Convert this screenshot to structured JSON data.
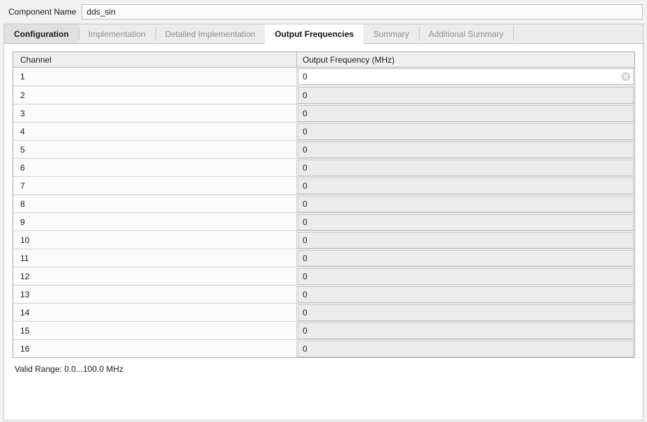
{
  "component": {
    "label": "Component Name",
    "value": "dds_sin",
    "placeholder": ""
  },
  "tabs": [
    {
      "label": "Configuration",
      "state": "selected"
    },
    {
      "label": "Implementation",
      "state": "inactive"
    },
    {
      "label": "Detailed Implementation",
      "state": "inactive"
    },
    {
      "label": "Output Frequencies",
      "state": "active"
    },
    {
      "label": "Summary",
      "state": "inactive"
    },
    {
      "label": "Additional Summary",
      "state": "inactive"
    }
  ],
  "table": {
    "columns": [
      "Channel",
      "Output Frequency (MHz)"
    ],
    "rows": [
      {
        "channel": "1",
        "frequency": "0",
        "focused": true
      },
      {
        "channel": "2",
        "frequency": "0",
        "focused": false
      },
      {
        "channel": "3",
        "frequency": "0",
        "focused": false
      },
      {
        "channel": "4",
        "frequency": "0",
        "focused": false
      },
      {
        "channel": "5",
        "frequency": "0",
        "focused": false
      },
      {
        "channel": "6",
        "frequency": "0",
        "focused": false
      },
      {
        "channel": "7",
        "frequency": "0",
        "focused": false
      },
      {
        "channel": "8",
        "frequency": "0",
        "focused": false
      },
      {
        "channel": "9",
        "frequency": "0",
        "focused": false
      },
      {
        "channel": "10",
        "frequency": "0",
        "focused": false
      },
      {
        "channel": "11",
        "frequency": "0",
        "focused": false
      },
      {
        "channel": "12",
        "frequency": "0",
        "focused": false
      },
      {
        "channel": "13",
        "frequency": "0",
        "focused": false
      },
      {
        "channel": "14",
        "frequency": "0",
        "focused": false
      },
      {
        "channel": "15",
        "frequency": "0",
        "focused": false
      },
      {
        "channel": "16",
        "frequency": "0",
        "focused": false
      }
    ],
    "clear_icon": "clear-circle-x-icon"
  },
  "footer": {
    "valid_range": "Valid Range: 0.0...100.0 MHz"
  },
  "colors": {
    "window_bg": "#f2f2f2",
    "panel_bg": "#ffffff",
    "tabstrip_bg": "#ececec",
    "tab_selected_bg": "#e0e0e0",
    "tab_inactive_text": "#8e8e8e",
    "table_border": "#a9a9a9",
    "row_bg": "#fbfbfb",
    "header_bg": "#efefef",
    "input_bg": "#ececec",
    "text": "#1a1a1a"
  }
}
